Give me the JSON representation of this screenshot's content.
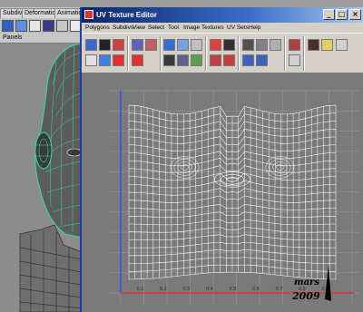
{
  "main_window": {
    "shelf_tabs": [
      "Subdivs",
      "Deformation",
      "Animation"
    ],
    "panels_label": "Panels"
  },
  "uv_editor": {
    "title": "UV Texture Editor",
    "menus": [
      "Polygons",
      "Subdivs",
      "View",
      "Select",
      "Tool",
      "Image",
      "Textures",
      "UV Sets",
      "Help"
    ],
    "window_buttons": {
      "minimize": "_",
      "maximize": "□",
      "close": "×"
    }
  },
  "grid": {
    "tick_labels": [
      "0.1",
      "0.2",
      "0.3",
      "0.4",
      "0.5",
      "0.6",
      "0.7",
      "0.8",
      "0.9"
    ]
  },
  "watermark": {
    "name": "mars",
    "year": "2009"
  },
  "colors": {
    "titlebar": "#0a246a",
    "wire_green": "#33e0a0",
    "uv_wire": "#ffffff",
    "axis_v": "#2040ff",
    "axis_u": "#ff2020"
  }
}
